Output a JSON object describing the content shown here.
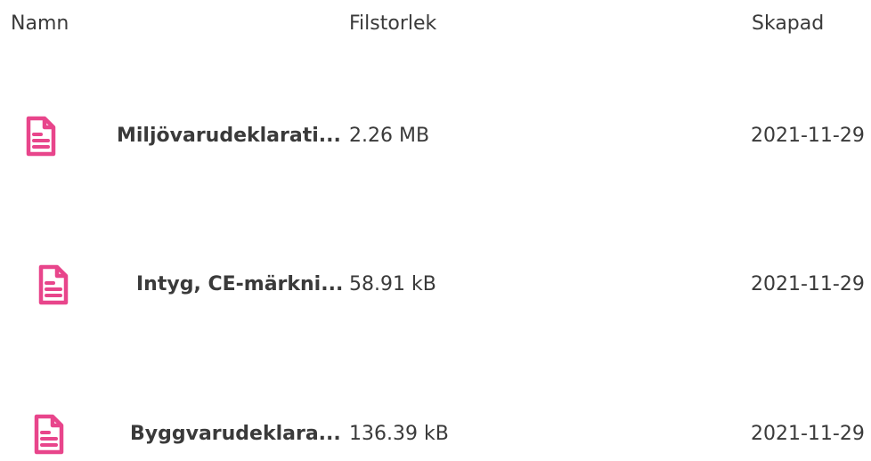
{
  "columns": {
    "name": "Namn",
    "size": "Filstorlek",
    "created": "Skapad"
  },
  "accent_color": "#e8458b",
  "rows": [
    {
      "icon": "document-icon",
      "name": "Miljövarudeklarati...",
      "size": "2.26 MB",
      "created": "2021-11-29"
    },
    {
      "icon": "document-icon",
      "name": "Intyg, CE-märkni...",
      "size": "58.91 kB",
      "created": "2021-11-29"
    },
    {
      "icon": "document-icon",
      "name": "Byggvarudeklara...",
      "size": "136.39 kB",
      "created": "2021-11-29"
    }
  ]
}
